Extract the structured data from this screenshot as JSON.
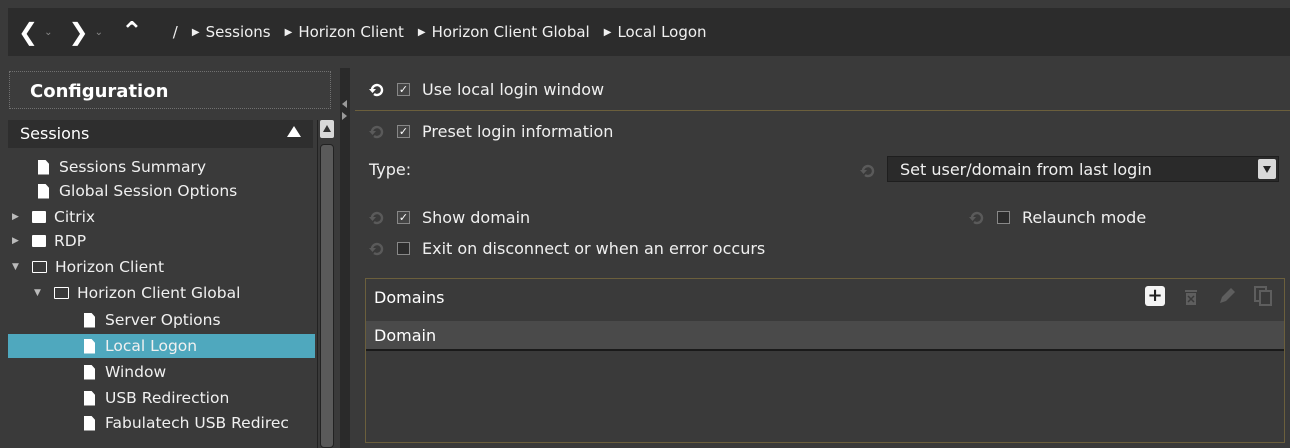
{
  "nav": {
    "back_label": "❮",
    "forward_label": "❯",
    "up_label": "⌃",
    "dropdown_glyph": "⌄",
    "root": "/"
  },
  "breadcrumbs": [
    "Sessions",
    "Horizon Client",
    "Horizon Client Global",
    "Local Logon"
  ],
  "sidebar": {
    "title": "Configuration",
    "section": "Sessions",
    "items": [
      {
        "label": "Sessions Summary",
        "icon": "file-icon"
      },
      {
        "label": "Global Session Options",
        "icon": "file-icon"
      },
      {
        "label": "Citrix",
        "icon": "folder-icon"
      },
      {
        "label": "RDP",
        "icon": "folder-icon"
      },
      {
        "label": "Horizon Client",
        "icon": "folder-open-icon"
      },
      {
        "label": "Horizon Client Global",
        "icon": "folder-open-icon"
      },
      {
        "label": "Server Options",
        "icon": "file-icon"
      },
      {
        "label": "Local Logon",
        "icon": "file-icon",
        "selected": true
      },
      {
        "label": "Window",
        "icon": "file-icon"
      },
      {
        "label": "USB Redirection",
        "icon": "file-icon"
      },
      {
        "label": "Fabulatech USB Redirec",
        "icon": "file-icon"
      }
    ]
  },
  "settings": {
    "use_local_login": {
      "label": "Use local login window",
      "checked": true
    },
    "preset_login": {
      "label": "Preset login information",
      "checked": true
    },
    "type_label": "Type:",
    "type_value": "Set user/domain from last login",
    "show_domain": {
      "label": "Show domain",
      "checked": true
    },
    "relaunch_mode": {
      "label": "Relaunch mode",
      "checked": false
    },
    "exit_on_disconnect": {
      "label": "Exit on disconnect or when an error occurs",
      "checked": false
    }
  },
  "domains": {
    "title": "Domains",
    "column": "Domain",
    "rows": []
  },
  "colors": {
    "selection": "#4fa8be",
    "background": "#3a3a3a",
    "topbar": "#2c2c2c",
    "separator": "#6b5f3c"
  }
}
